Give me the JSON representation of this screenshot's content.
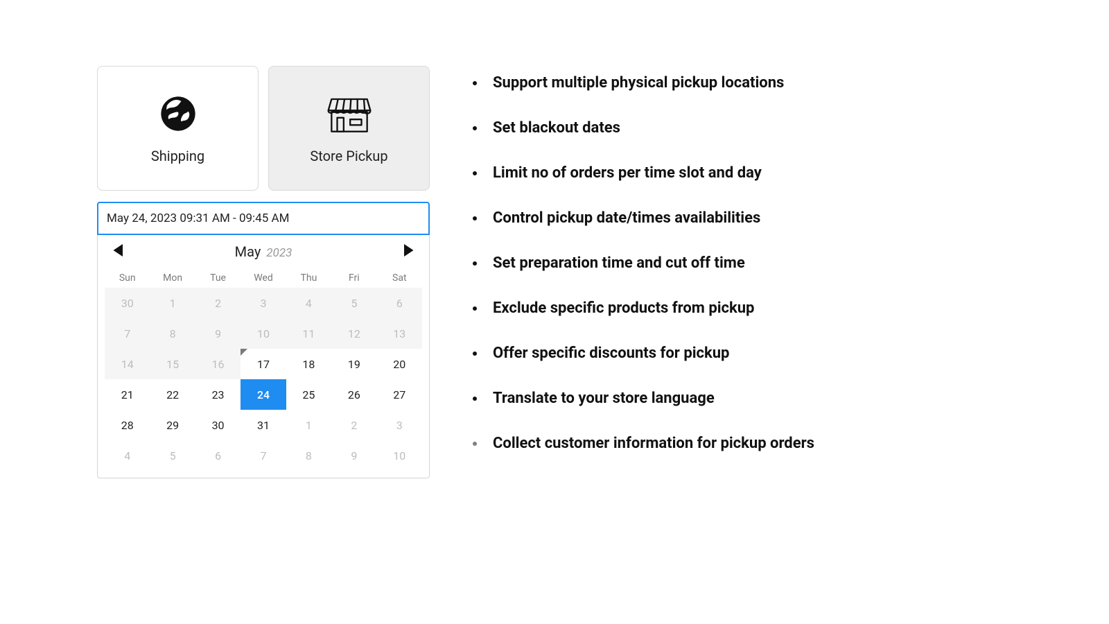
{
  "tabs": {
    "shipping_label": "Shipping",
    "pickup_label": "Store Pickup"
  },
  "date_input_value": "May 24, 2023 09:31 AM - 09:45 AM",
  "calendar": {
    "month": "May",
    "year": "2023",
    "dow": [
      "Sun",
      "Mon",
      "Tue",
      "Wed",
      "Thu",
      "Fri",
      "Sat"
    ],
    "cells": [
      {
        "n": "30",
        "state": "disabled muted"
      },
      {
        "n": "1",
        "state": "disabled muted"
      },
      {
        "n": "2",
        "state": "disabled muted"
      },
      {
        "n": "3",
        "state": "disabled muted"
      },
      {
        "n": "4",
        "state": "disabled muted"
      },
      {
        "n": "5",
        "state": "disabled muted"
      },
      {
        "n": "6",
        "state": "disabled muted"
      },
      {
        "n": "7",
        "state": "disabled muted"
      },
      {
        "n": "8",
        "state": "disabled muted"
      },
      {
        "n": "9",
        "state": "disabled muted"
      },
      {
        "n": "10",
        "state": "disabled muted"
      },
      {
        "n": "11",
        "state": "disabled muted"
      },
      {
        "n": "12",
        "state": "disabled muted"
      },
      {
        "n": "13",
        "state": "disabled muted"
      },
      {
        "n": "14",
        "state": "disabled muted"
      },
      {
        "n": "15",
        "state": "disabled muted"
      },
      {
        "n": "16",
        "state": "disabled muted"
      },
      {
        "n": "17",
        "state": "today-mark"
      },
      {
        "n": "18",
        "state": ""
      },
      {
        "n": "19",
        "state": ""
      },
      {
        "n": "20",
        "state": ""
      },
      {
        "n": "21",
        "state": ""
      },
      {
        "n": "22",
        "state": ""
      },
      {
        "n": "23",
        "state": ""
      },
      {
        "n": "24",
        "state": "selected"
      },
      {
        "n": "25",
        "state": ""
      },
      {
        "n": "26",
        "state": ""
      },
      {
        "n": "27",
        "state": ""
      },
      {
        "n": "28",
        "state": ""
      },
      {
        "n": "29",
        "state": ""
      },
      {
        "n": "30",
        "state": ""
      },
      {
        "n": "31",
        "state": ""
      },
      {
        "n": "1",
        "state": "muted"
      },
      {
        "n": "2",
        "state": "muted"
      },
      {
        "n": "3",
        "state": "muted"
      },
      {
        "n": "4",
        "state": "muted"
      },
      {
        "n": "5",
        "state": "muted"
      },
      {
        "n": "6",
        "state": "muted"
      },
      {
        "n": "7",
        "state": "muted"
      },
      {
        "n": "8",
        "state": "muted"
      },
      {
        "n": "9",
        "state": "muted"
      },
      {
        "n": "10",
        "state": "muted"
      }
    ]
  },
  "features": [
    "Support multiple physical pickup locations",
    "Set blackout dates",
    "Limit no of orders per time slot and day",
    "Control pickup date/times availabilities",
    "Set preparation time and cut off time",
    "Exclude specific products from pickup",
    "Offer specific discounts for pickup",
    "Translate to your store language",
    "Collect customer information for pickup orders"
  ]
}
